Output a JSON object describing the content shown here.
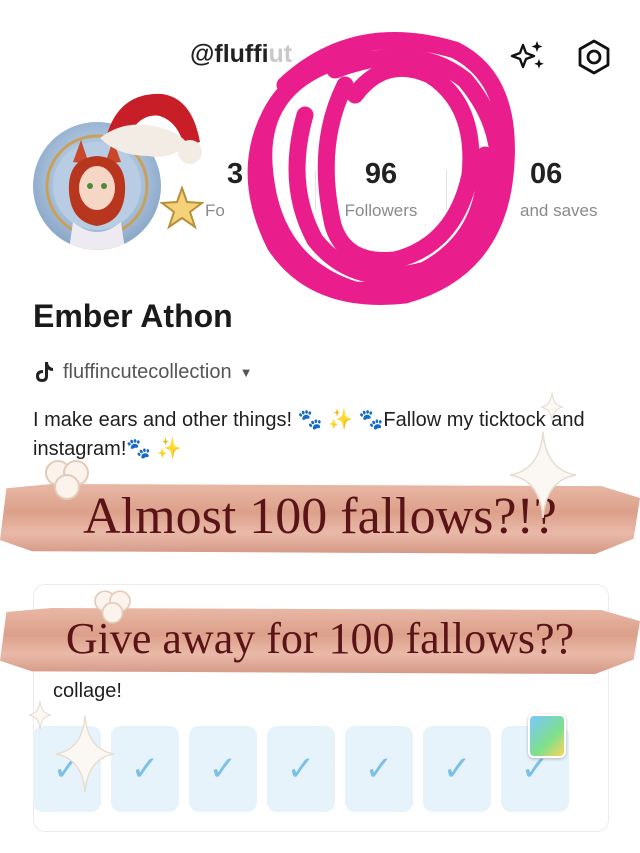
{
  "header": {
    "handle": "@fluffi",
    "handle_tail": "ut"
  },
  "profile": {
    "name": "Ember Athon",
    "tiktok_name": "fluffincutecollection",
    "bio": "I make ears and other things! 🐾 ✨ 🐾Fallow my ticktock and instagram!🐾 ✨"
  },
  "stats": [
    {
      "value": "3",
      "label": "Fo"
    },
    {
      "value": "96",
      "label": "Followers"
    },
    {
      "value": "06",
      "label": "and saves"
    }
  ],
  "banners": {
    "top": "Almost 100 fallows?!?",
    "bottom": "Give away for 100 fallows??"
  },
  "card": {
    "subtitle": "collage!",
    "checks": [
      "✓",
      "✓",
      "✓",
      "✓",
      "✓",
      "✓",
      "✓"
    ]
  },
  "colors": {
    "scribble": "#e91e8c",
    "banner": "#dca08a",
    "banner_text": "#5a1418",
    "check": "#7cc0e6",
    "check_bg": "#e6f3fb"
  },
  "icons": {
    "sparkle": "sparkle-icon",
    "settings": "settings-icon",
    "tiktok": "tiktok-icon",
    "dropdown": "caret-down-icon"
  }
}
